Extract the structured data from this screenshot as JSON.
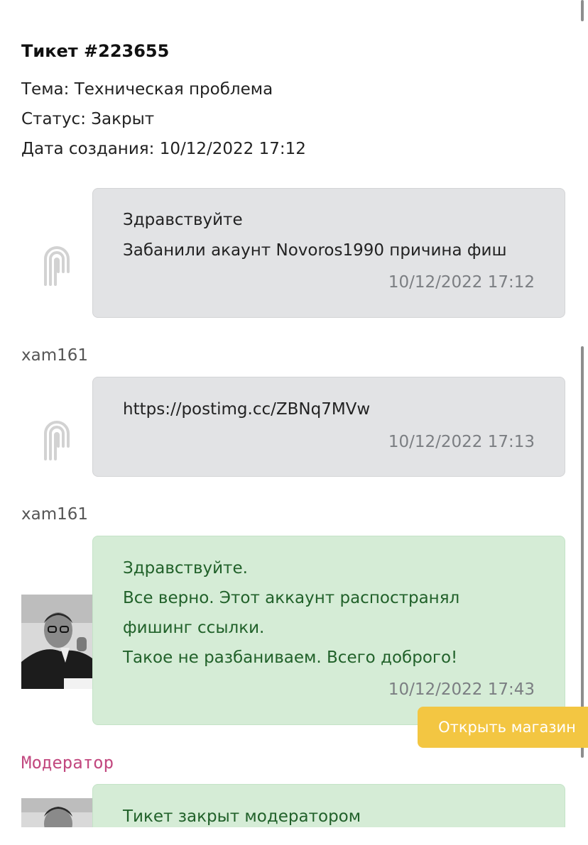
{
  "ticket": {
    "title": "Тикет #223655",
    "subject": "Тема: Техническая проблема",
    "status": "Статус: Закрыт",
    "created": "Дата создания: 10/12/2022 17:12"
  },
  "messages": [
    {
      "lines": [
        "Здравствуйте",
        "Забанили акаунт Novoros1990 причина фиш"
      ],
      "time": "10/12/2022 17:12",
      "author": "xam161",
      "icon": "user-logo-icon"
    },
    {
      "lines": [
        "https://postimg.cc/ZBNq7MVw"
      ],
      "time": "10/12/2022 17:13",
      "author": "xam161",
      "icon": "user-logo-icon"
    },
    {
      "lines": [
        "Здравствуйте.",
        "Все верно. Этот аккаунт распостранял",
        "фишинг ссылки.",
        "Такое не разбаниваем. Всего доброго!"
      ],
      "time": "10/12/2022 17:43",
      "author": "Модератор",
      "icon": "moderator-avatar"
    },
    {
      "lines": [
        "Тикет закрыт модератором"
      ],
      "icon": "moderator-avatar"
    }
  ],
  "shop_button": "Открыть магазин",
  "colors": {
    "grey_bubble": "#e2e3e5",
    "green_bubble": "#d5ecd6",
    "green_text": "#21612a",
    "moderator_name": "#c2487f",
    "shop_button": "#f3c642"
  }
}
